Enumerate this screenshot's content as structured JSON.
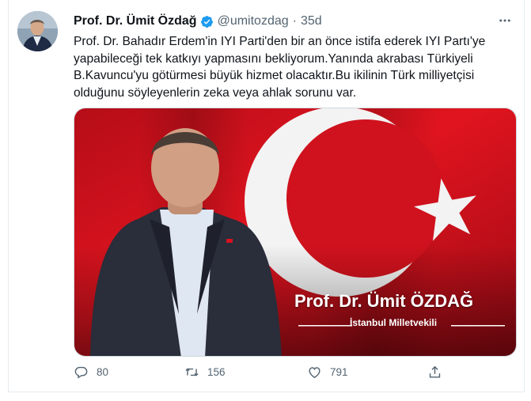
{
  "tweet": {
    "author_name": "Prof. Dr. Ümit Özdağ",
    "handle": "@umitozdag",
    "separator": "·",
    "time": "35d",
    "text_lines": [
      "Prof. Dr. Bahadır Erdem'in IYI Parti'den bir an önce istifa ederek IYI Partı'ye",
      "yapabileceği tek katkıyı yapmasını bekliyorum.Yanında akrabası Türkiyeli",
      "B.Kavuncu'yu götürmesi büyük hizmet olacaktır.Bu ikilinin Türk milliyetçisi",
      "olduğunu söyleyenlerin zeka veya ahlak sorunu var."
    ],
    "media": {
      "overlay_name": "Prof. Dr. Ümit ÖZDAĞ",
      "overlay_subtitle": "İstanbul Milletvekili"
    },
    "actions": {
      "reply_count": "80",
      "retweet_count": "156",
      "like_count": "791"
    },
    "icons": {
      "verified": "verified-badge-icon",
      "more": "more-icon",
      "reply": "reply-icon",
      "retweet": "retweet-icon",
      "like": "like-icon",
      "share": "share-icon"
    },
    "colors": {
      "verified_blue": "#1d9bf0",
      "flag_red": "#d8121f",
      "secondary_text": "#536471"
    }
  }
}
